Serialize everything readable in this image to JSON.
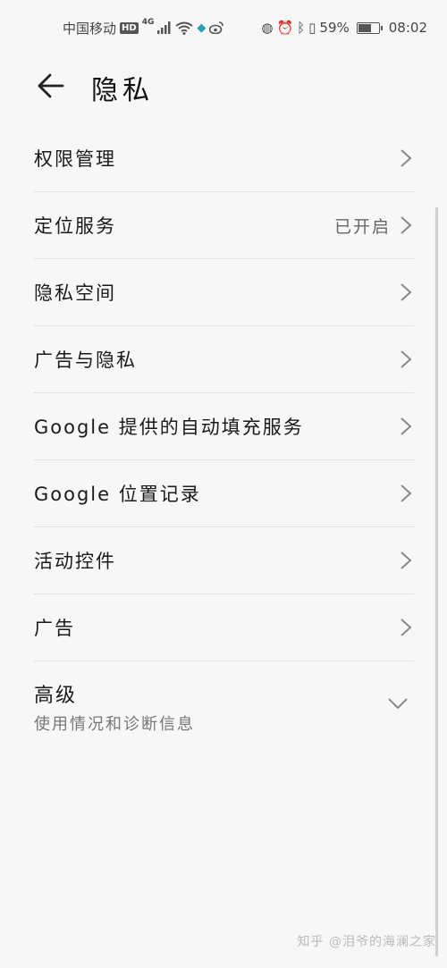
{
  "status_bar": {
    "carrier": "中国移动",
    "hd_badge": "HD",
    "network_type": "4G",
    "signal_icon": "cellular-signal-icon",
    "wifi_icon": "wifi-icon",
    "battery_percent": "59%",
    "battery_level": 0.59,
    "time": "08:02"
  },
  "header": {
    "back_icon": "arrow-left-icon",
    "title": "隐私"
  },
  "list": {
    "items": [
      {
        "label": "权限管理",
        "value": ""
      },
      {
        "label": "定位服务",
        "value": "已开启"
      },
      {
        "label": "隐私空间",
        "value": ""
      },
      {
        "label": "广告与隐私",
        "value": ""
      },
      {
        "label": "Google 提供的自动填充服务",
        "value": ""
      },
      {
        "label": "Google 位置记录",
        "value": ""
      },
      {
        "label": "活动控件",
        "value": ""
      },
      {
        "label": "广告",
        "value": ""
      }
    ],
    "advanced": {
      "title": "高级",
      "subtitle": "使用情况和诊断信息"
    }
  },
  "watermark": "知乎 @泪爷的海澜之家",
  "colors": {
    "background": "#f7f7f7",
    "divider": "#e2e2e2",
    "text_primary": "#1a1a1a",
    "text_secondary": "#777777"
  }
}
